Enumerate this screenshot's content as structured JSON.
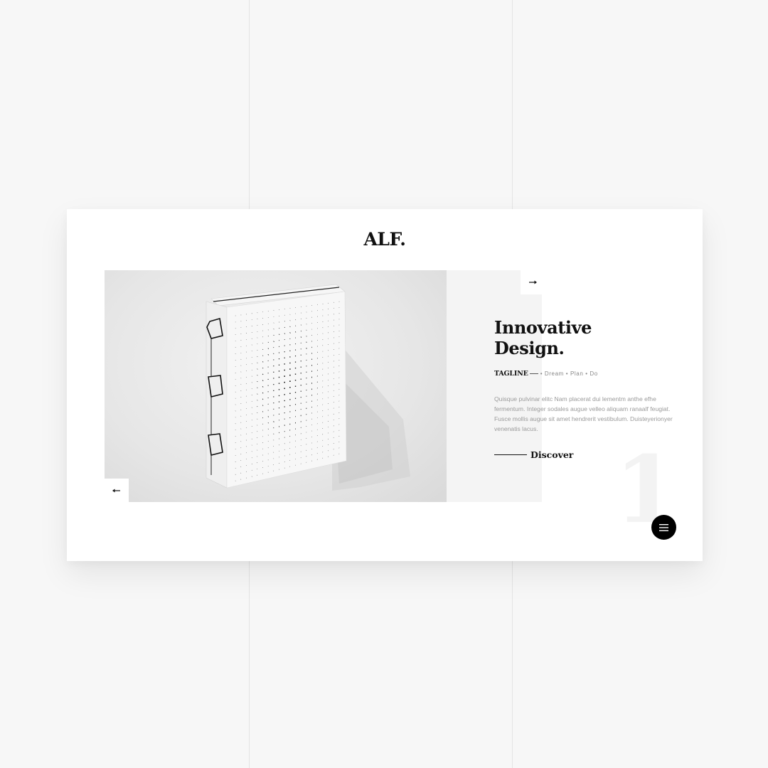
{
  "brand": {
    "logo": "ALF."
  },
  "slide": {
    "number": "1",
    "title_line1": "Innovative",
    "title_line2": "Design.",
    "tagline_label": "TAGLINE",
    "tagline_words": "• Dream • Plan • Do",
    "description": "Quisque pulvinar elitc Nam placerat dui lementm anthe efhe fermentum. Integer sodales augue velleo aliquam ranaalf feugiat. Fusce mollis augue sit amet hendrerit vestibulum. Duisteyerionyer venenatis lacus.",
    "cta_label": "Discover",
    "image_subject": "dot-pattern-notebook"
  },
  "icons": {
    "prev": "arrow-left-icon",
    "next": "arrow-right-icon",
    "menu": "hamburger-menu-icon"
  },
  "colors": {
    "accent": "#000000",
    "background": "#f7f7f7",
    "card": "#ffffff",
    "panel": "#f4f4f4",
    "body_text": "#9a9a9a"
  }
}
